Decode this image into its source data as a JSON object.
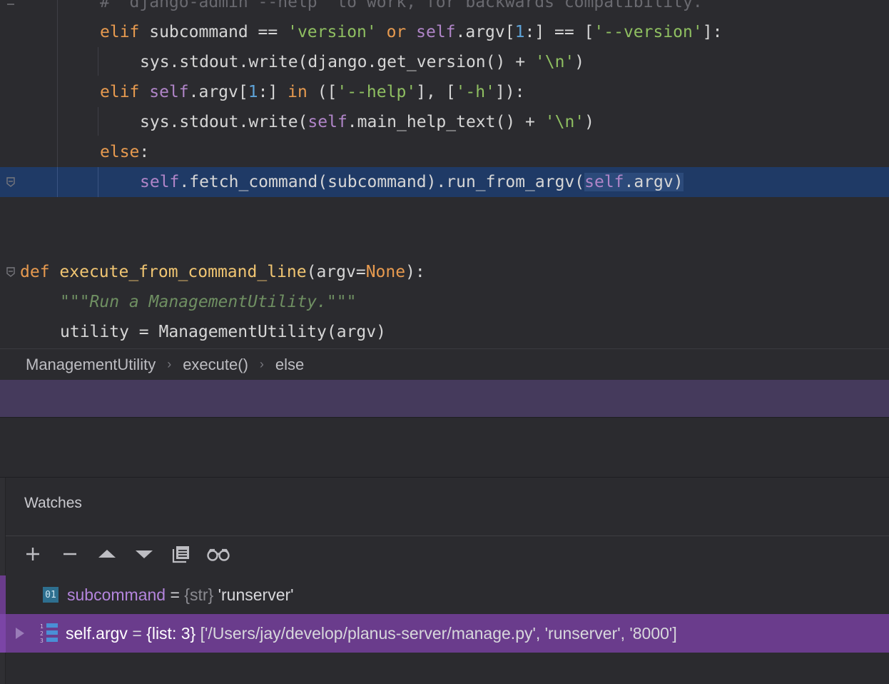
{
  "code": {
    "line0": "#  django-admin --help  to work, for backwards compatibility.",
    "line1": {
      "k1": "elif",
      "a": " subcommand == ",
      "s1": "'version'",
      "k2": " or ",
      "self": "self",
      "b": ".argv[",
      "n": "1",
      "c": ":] == [",
      "s2": "'--version'",
      "d": "]:"
    },
    "line2": {
      "a": "sys.stdout.write(django.get_version() + ",
      "s": "'\\n'",
      "b": ")"
    },
    "line3": {
      "k": "elif",
      "a": " ",
      "self": "self",
      "b": ".argv[",
      "n": "1",
      "c": ":] ",
      "k2": "in",
      "d": " ([",
      "s1": "'--help'",
      "e": "], [",
      "s2": "'-h'",
      "f": "]):"
    },
    "line4": {
      "a": "sys.stdout.write(",
      "self": "self",
      "b": ".main_help_text() + ",
      "s": "'\\n'",
      "c": ")"
    },
    "line5": {
      "k": "else",
      "a": ":"
    },
    "line6": {
      "self1": "self",
      "a": ".fetch_command(subcommand).run_from_argv(",
      "self2": "self",
      "b": ".argv)"
    },
    "line9": {
      "k": "def",
      "a": " ",
      "fn": "execute_from_command_line",
      "b": "(argv=",
      "k2": "None",
      "c": "):"
    },
    "line10": "\"\"\"Run a ManagementUtility.\"\"\"",
    "line11": "utility = ManagementUtility(argv)"
  },
  "breadcrumbs": [
    "ManagementUtility",
    "execute()",
    "else"
  ],
  "breadcrumb_separator": "›",
  "watches": {
    "title": "Watches",
    "toolbar": {
      "add": "+",
      "remove": "−"
    },
    "items": [
      {
        "icon": "01",
        "name": "subcommand",
        "eq": " = ",
        "type": "{str}",
        "value": " 'runserver'"
      },
      {
        "name": "self.argv",
        "eq": " = ",
        "type": "{list: 3}",
        "value": " ['/Users/jay/develop/planus-server/manage.py', 'runserver', '8000']"
      }
    ]
  },
  "colors": {
    "editor_bg": "#2b2b2f",
    "current_line": "#1f3a66",
    "selected_watch": "#6a3c8c",
    "purple_bar": "#453a5c"
  }
}
